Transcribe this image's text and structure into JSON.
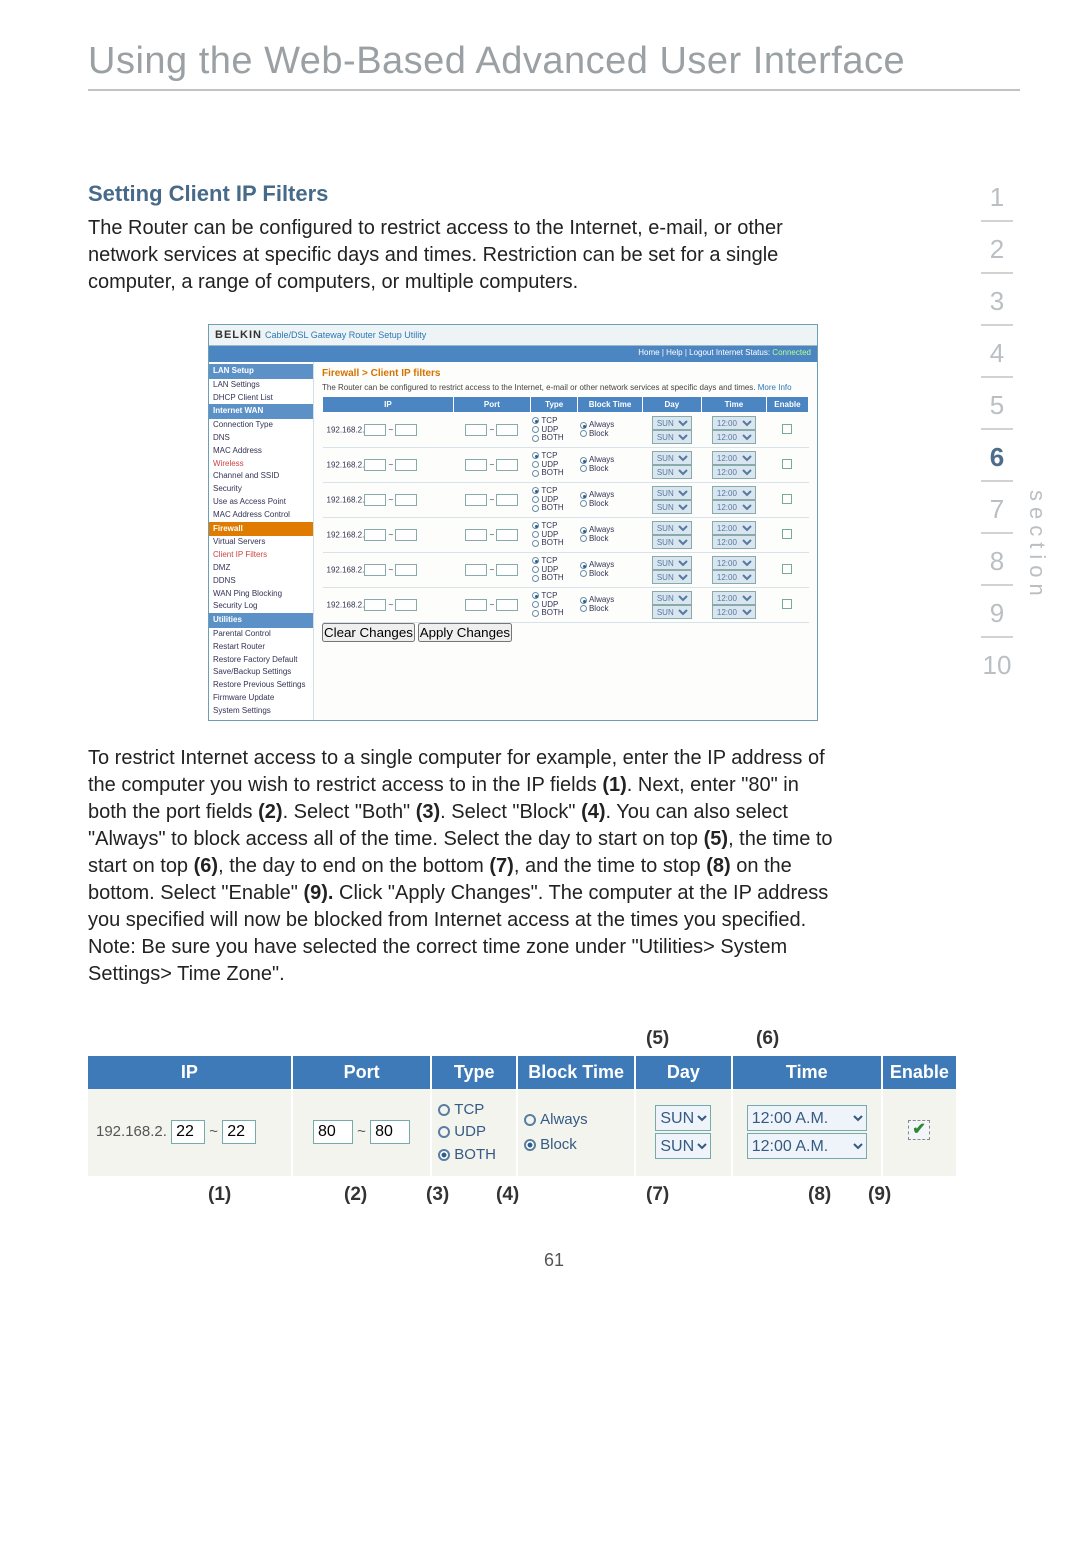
{
  "title": "Using the Web-Based Advanced User Interface",
  "subtitle": "Setting Client IP Filters",
  "intro": "The Router can be configured to restrict access to the Internet, e-mail, or other network services at specific days and times. Restriction can be set for a single computer, a range of computers, or multiple computers.",
  "body_parts": {
    "p1a": "To restrict Internet access to a single computer for example, enter the IP address of the computer you wish to restrict access to in the IP fields ",
    "r1": "(1)",
    "p1b": ". Next, enter \"80\" in both the port fields ",
    "r2": "(2)",
    "p1c": ". Select \"Both\" ",
    "r3": "(3)",
    "p1d": ". Select \"Block\" ",
    "r4": "(4)",
    "p1e": ". You can also select \"Always\" to block access all of the time. Select the day to start on top ",
    "r5": "(5)",
    "p1f": ", the time to start on top ",
    "r6": "(6)",
    "p1g": ", the day to end on the bottom ",
    "r7": "(7)",
    "p1h": ", and the time to stop ",
    "r8": "(8)",
    "p1i": " on the bottom. Select \"Enable\" ",
    "r9": "(9).",
    "p1j": " Click \"Apply Changes\". The computer at the IP address you specified will now be blocked from Internet access at the times you specified. Note: Be sure you have selected the correct time zone under \"Utilities> System Settings> Time Zone\"."
  },
  "section_nav": [
    "1",
    "2",
    "3",
    "4",
    "5",
    "6",
    "7",
    "8",
    "9",
    "10"
  ],
  "section_current": "6",
  "section_label": "section",
  "page_number": "61",
  "router": {
    "brand": "BELKIN",
    "tagline": "Cable/DSL Gateway Router Setup Utility",
    "topbar": "Home | Help | Logout   Internet Status: ",
    "status": "Connected",
    "breadcrumb": "Firewall > Client IP filters",
    "desc": "The Router can be configured to restrict access to the Internet, e-mail or other network services at specific days and times. ",
    "more": "More Info",
    "side": [
      {
        "t": "LAN Setup",
        "k": "cat"
      },
      {
        "t": "LAN Settings"
      },
      {
        "t": "DHCP Client List"
      },
      {
        "t": "Internet WAN",
        "k": "cat"
      },
      {
        "t": "Connection Type"
      },
      {
        "t": "DNS"
      },
      {
        "t": "MAC Address"
      },
      {
        "t": "Wireless",
        "k": "hot"
      },
      {
        "t": "Channel and SSID"
      },
      {
        "t": "Security"
      },
      {
        "t": "Use as Access Point"
      },
      {
        "t": "MAC Address Control"
      },
      {
        "t": "Firewall",
        "k": "catO"
      },
      {
        "t": "Virtual Servers"
      },
      {
        "t": "Client IP Filters",
        "k": "hot"
      },
      {
        "t": "DMZ"
      },
      {
        "t": "DDNS"
      },
      {
        "t": "WAN Ping Blocking"
      },
      {
        "t": "Security Log"
      },
      {
        "t": "Utilities",
        "k": "cat"
      },
      {
        "t": "Parental Control"
      },
      {
        "t": "Restart Router"
      },
      {
        "t": "Restore Factory Default"
      },
      {
        "t": "Save/Backup Settings"
      },
      {
        "t": "Restore Previous Settings"
      },
      {
        "t": "Firmware Update"
      },
      {
        "t": "System Settings"
      }
    ],
    "cols": [
      "IP",
      "Port",
      "Type",
      "Block Time",
      "Day",
      "Time",
      "Enable"
    ],
    "ip_prefix": "192.168.2.",
    "type_opts": [
      "TCP",
      "UDP",
      "BOTH"
    ],
    "bt_opts": [
      "Always",
      "Block"
    ],
    "day": "SUN",
    "time": "12:00 A.M.",
    "btn_clear": "Clear Changes",
    "btn_apply": "Apply Changes",
    "rows": 6
  },
  "big": {
    "cols": [
      "IP",
      "Port",
      "Type",
      "Block Time",
      "Day",
      "Time",
      "Enable"
    ],
    "ip_prefix": "192.168.2.",
    "ip_from": "22",
    "ip_to": "22",
    "port_from": "80",
    "port_to": "80",
    "type_opts": [
      "TCP",
      "UDP",
      "BOTH"
    ],
    "type_sel": "BOTH",
    "bt_opts": [
      "Always",
      "Block"
    ],
    "bt_sel": "Block",
    "day": "SUN",
    "time": "12:00 A.M.",
    "call_top": {
      "5": "(5)",
      "6": "(6)"
    },
    "call_bot": {
      "1": "(1)",
      "2": "(2)",
      "3": "(3)",
      "4": "(4)",
      "7": "(7)",
      "8": "(8)",
      "9": "(9)"
    }
  }
}
